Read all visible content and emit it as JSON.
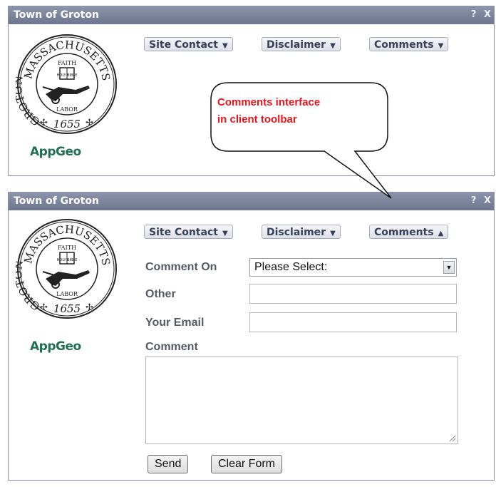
{
  "panels": [
    {
      "title": "Town of Groton",
      "help_label": "?",
      "close_label": "X",
      "toolbar": {
        "site_contact": "Site Contact",
        "disclaimer": "Disclaimer",
        "comments": "Comments",
        "site_contact_arrow": "▼",
        "disclaimer_arrow": "▼",
        "comments_arrow": "▼"
      }
    },
    {
      "title": "Town of Groton",
      "help_label": "?",
      "close_label": "X",
      "toolbar": {
        "site_contact": "Site Contact",
        "disclaimer": "Disclaimer",
        "comments": "Comments",
        "site_contact_arrow": "▼",
        "disclaimer_arrow": "▼",
        "comments_arrow": "▲"
      }
    }
  ],
  "seal": {
    "top_text": "MASSACHUSETTS",
    "left_text": "GROTON",
    "faith": "FAITH",
    "labor": "LABOR",
    "year": "1655",
    "bible": "HOLY BIBLE"
  },
  "logo": {
    "app": "App",
    "geo": "Geo"
  },
  "callout": {
    "line1": "Comments interface",
    "line2": "in client toolbar",
    "text_color": "#e8141b"
  },
  "form": {
    "comment_on_label": "Comment On",
    "comment_on_value": "Please Select:",
    "other_label": "Other",
    "other_value": "",
    "email_label": "Your Email",
    "email_value": "",
    "comment_label": "Comment",
    "comment_value": "",
    "send_label": "Send",
    "clear_label": "Clear Form"
  }
}
